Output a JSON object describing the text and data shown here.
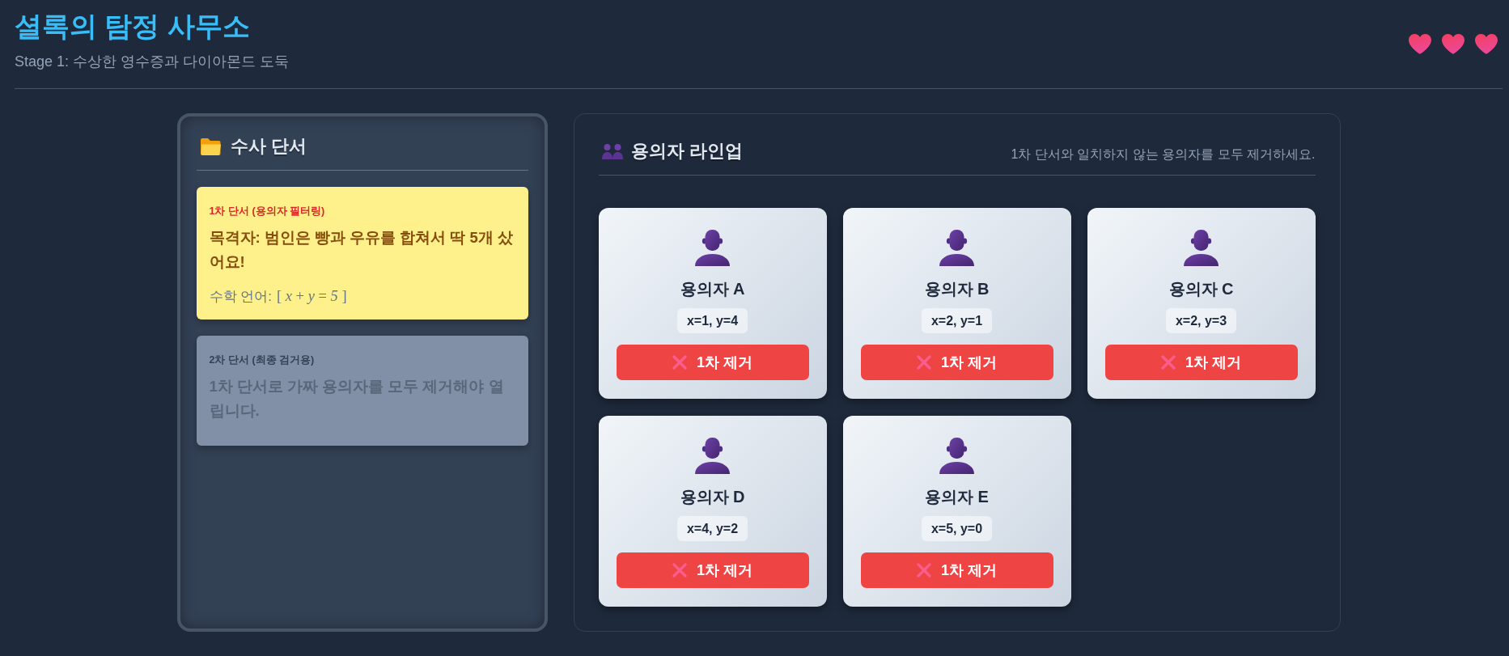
{
  "header": {
    "title": "셜록의 탐정 사무소",
    "subtitle": "Stage 1: 수상한 영수증과 다이아몬드 도둑",
    "lives": [
      {
        "filled": true
      },
      {
        "filled": true
      },
      {
        "filled": true
      }
    ]
  },
  "clue_panel": {
    "title": "수사 단서",
    "clues": [
      {
        "label": "1차 단서 (용의자 필터링)",
        "text": "목격자: 범인은 빵과 우유를 합쳐서 딱 5개 샀어요!",
        "math_label": "수학 언어:",
        "formula": "[ *x* + *y* = *5* ]",
        "locked": false
      },
      {
        "label": "2차 단서 (최종 검거용)",
        "text": "1차 단서로 가짜 용의자를 모두 제거해야 열립니다.",
        "locked": true
      }
    ]
  },
  "lineup": {
    "title": "용의자 라인업",
    "instruction": "1차 단서와 일치하지 않는 용의자를 모두 제거하세요.",
    "suspects": [
      {
        "name": "용의자 A",
        "values": "x=1, y=4",
        "button": "1차 제거"
      },
      {
        "name": "용의자 B",
        "values": "x=2, y=1",
        "button": "1차 제거"
      },
      {
        "name": "용의자 C",
        "values": "x=2, y=3",
        "button": "1차 제거"
      },
      {
        "name": "용의자 D",
        "values": "x=4, y=2",
        "button": "1차 제거"
      },
      {
        "name": "용의자 E",
        "values": "x=5, y=0",
        "button": "1차 제거"
      }
    ]
  }
}
